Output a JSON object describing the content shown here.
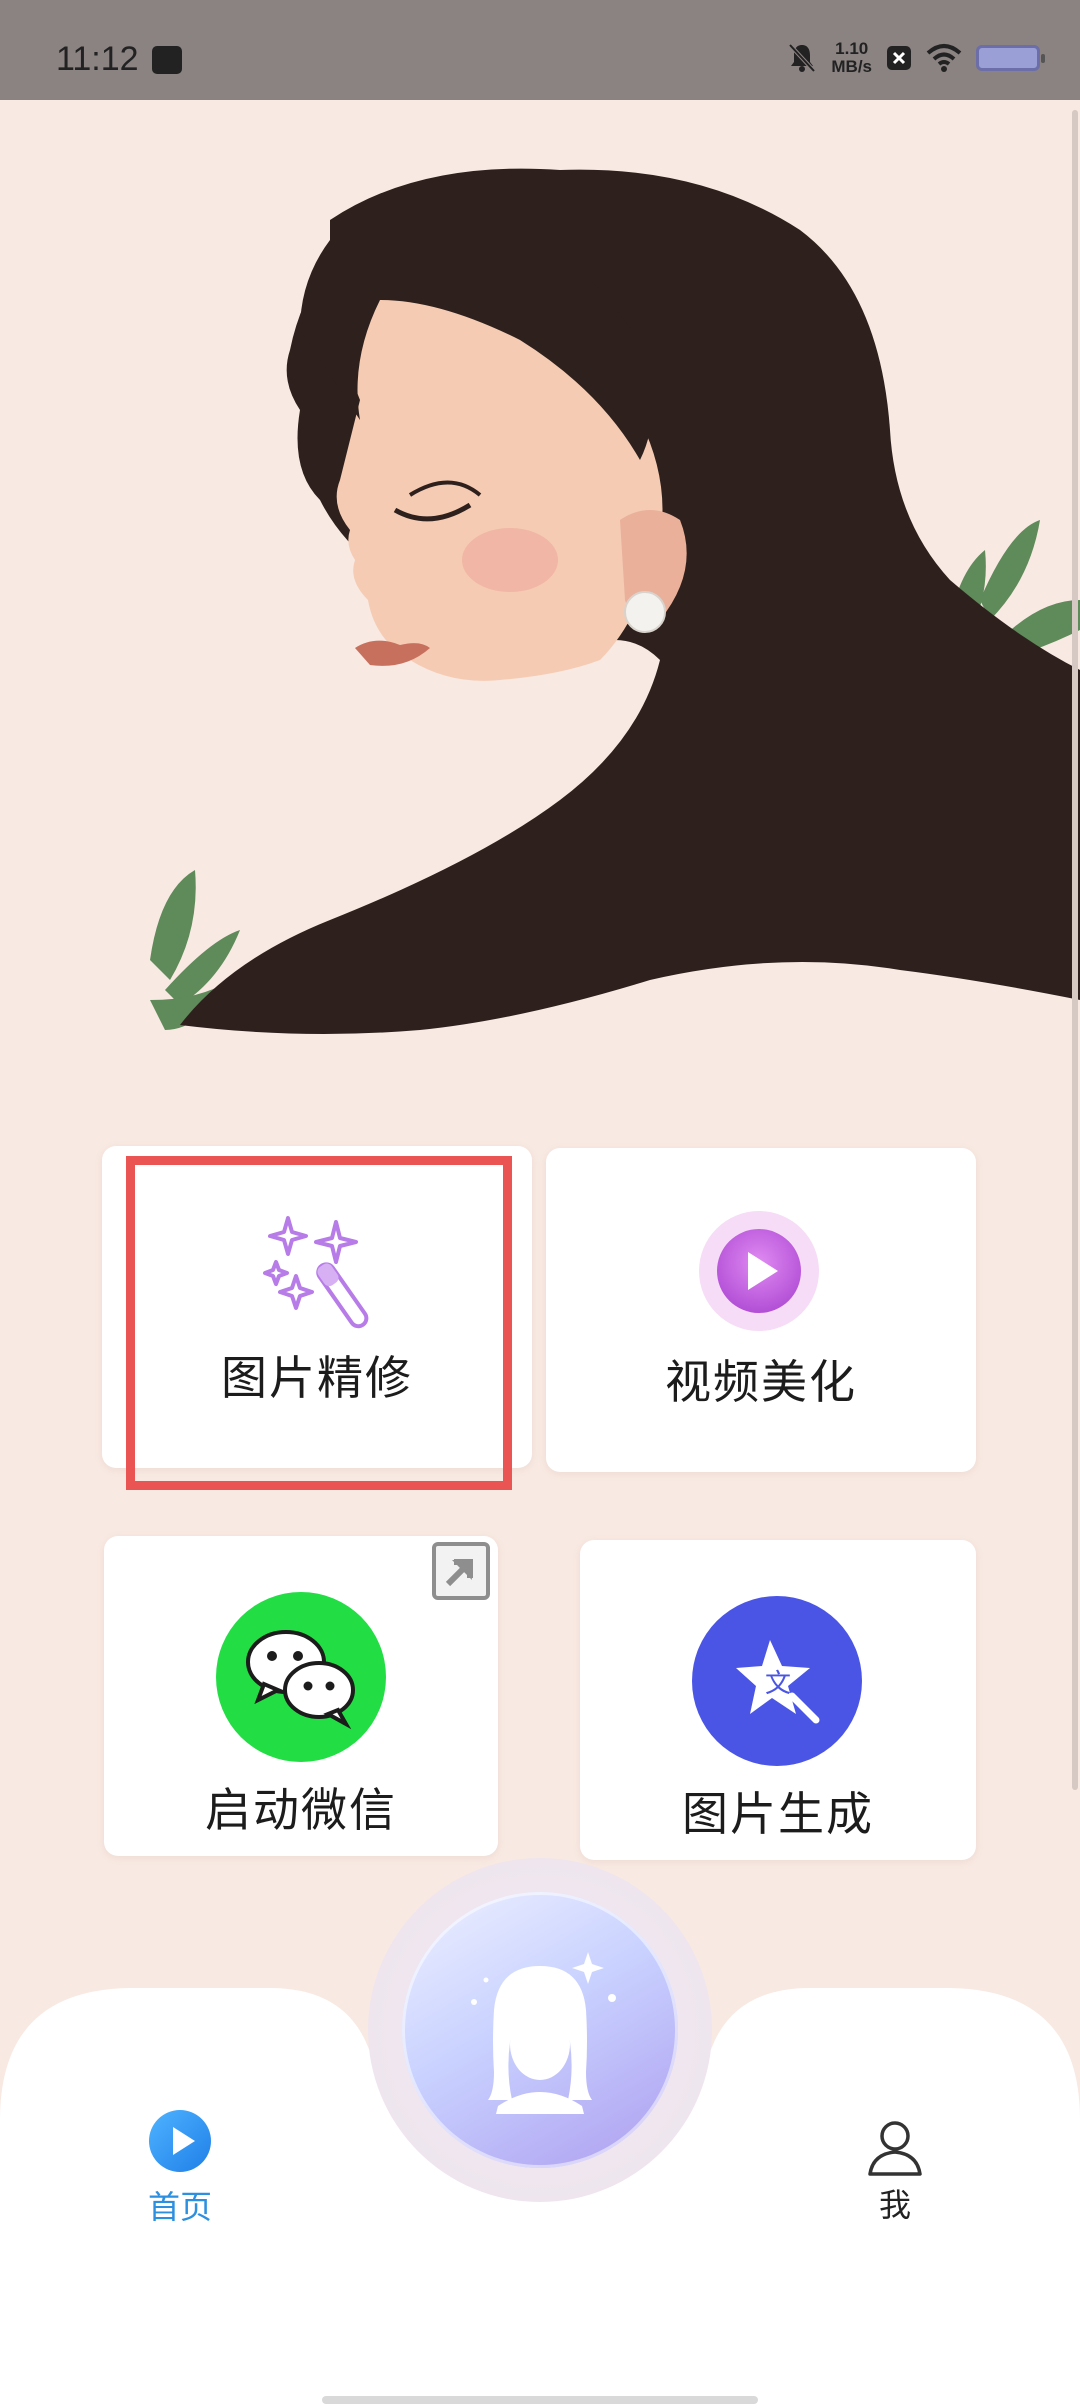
{
  "status_bar": {
    "time": "11:12",
    "net_speed_value": "1.10",
    "net_speed_unit": "MB/s"
  },
  "features": [
    {
      "label": "图片精修",
      "icon": "magic-wand-icon"
    },
    {
      "label": "视频美化",
      "icon": "play-circle-icon"
    },
    {
      "label": "启动微信",
      "icon": "wechat-icon"
    },
    {
      "label": "图片生成",
      "icon": "star-translate-icon"
    }
  ],
  "nav": {
    "home_label": "首页",
    "me_label": "我",
    "center_icon": "woman-avatar-icon"
  },
  "colors": {
    "accent_blue": "#2d8fe0",
    "highlight_red": "#ea5553",
    "wechat_green": "#22dd44",
    "generate_blue": "#4a55e6",
    "wand_purple": "#b77ce8"
  }
}
